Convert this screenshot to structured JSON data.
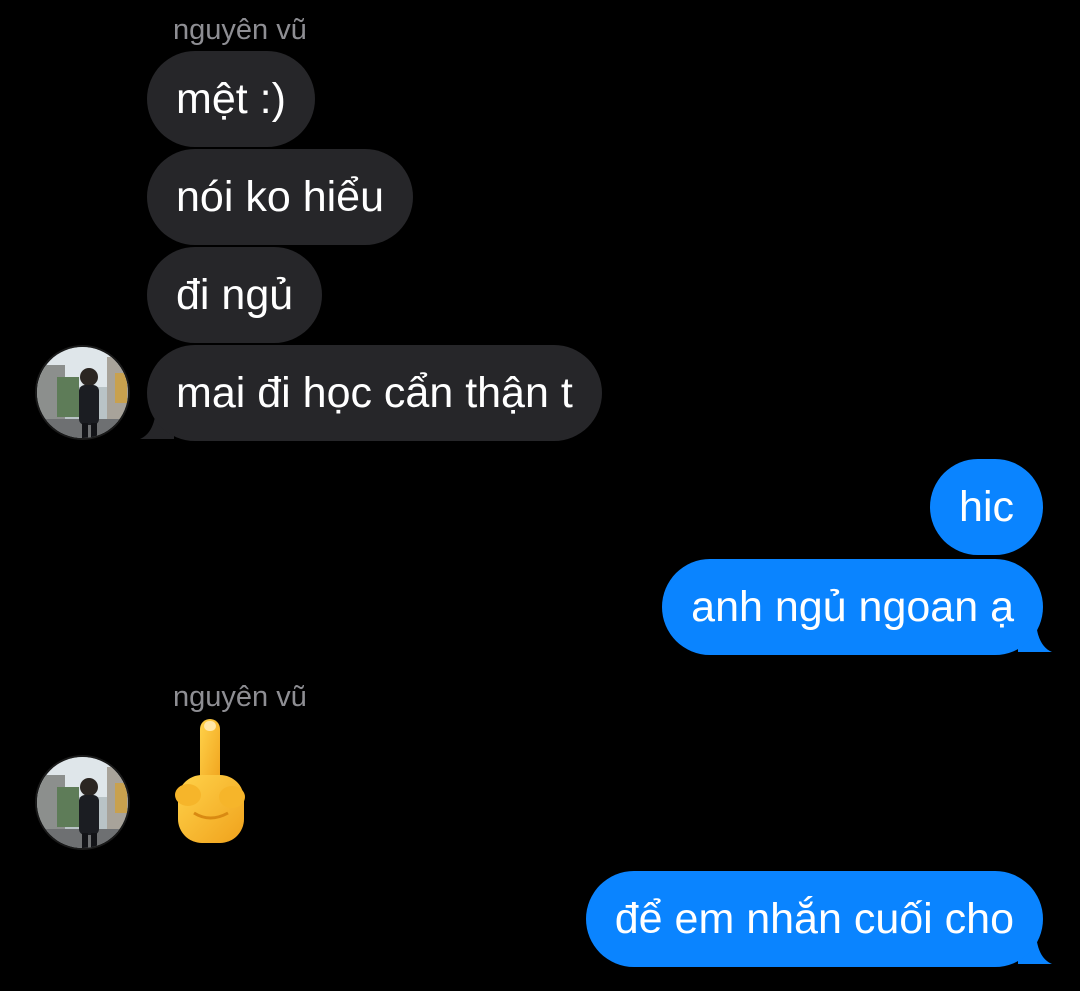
{
  "conversation": {
    "groups": [
      {
        "sender": "nguyên vũ",
        "direction": "incoming",
        "messages": [
          "mệt :)",
          "nói ko hiểu",
          "đi ngủ",
          "mai đi học cẩn thận t"
        ]
      },
      {
        "sender": "",
        "direction": "outgoing",
        "messages": [
          "hic",
          "anh ngủ ngoan ạ"
        ]
      },
      {
        "sender": "nguyên vũ",
        "direction": "incoming",
        "messages": [],
        "emoji": "middle-finger-emoji"
      },
      {
        "sender": "",
        "direction": "outgoing",
        "messages": [
          "để em nhắn cuối cho"
        ]
      }
    ]
  },
  "colors": {
    "background": "#000000",
    "incoming_bubble": "#262629",
    "outgoing_bubble": "#0a84ff",
    "sender_name": "#8e8e93"
  }
}
